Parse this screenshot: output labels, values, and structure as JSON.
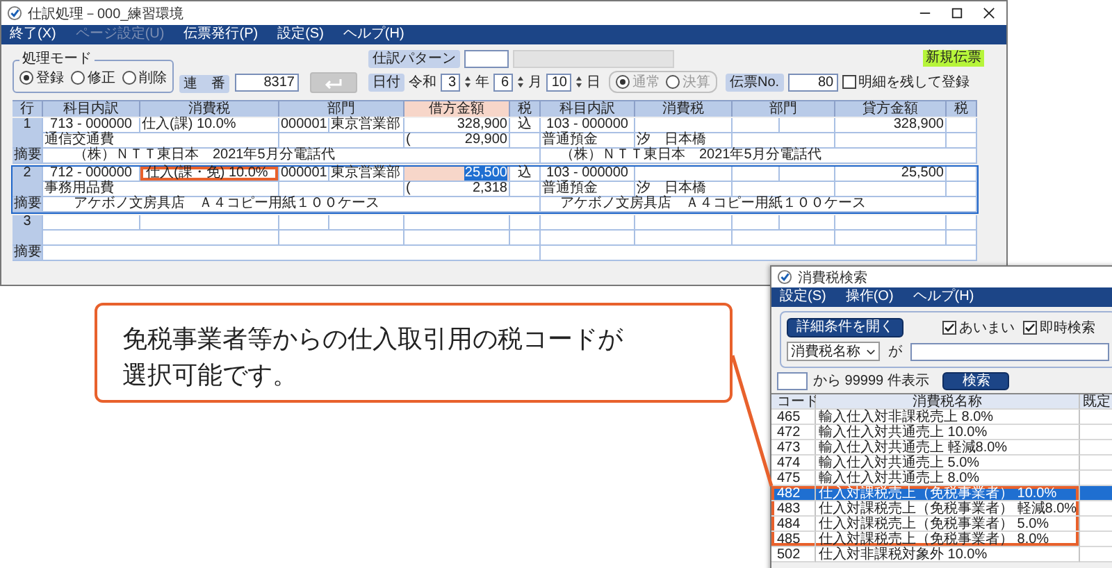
{
  "main_window": {
    "title": "仕訳処理－000_練習環境",
    "menu": [
      {
        "label": "終了(X)",
        "disabled": false
      },
      {
        "label": "ページ設定(U)",
        "disabled": true
      },
      {
        "label": "伝票発行(P)",
        "disabled": false
      },
      {
        "label": "設定(S)",
        "disabled": false
      },
      {
        "label": "ヘルプ(H)",
        "disabled": false
      }
    ],
    "mode": {
      "title": "処理モード",
      "options": [
        {
          "label": "登録",
          "selected": true
        },
        {
          "label": "修正",
          "selected": false
        },
        {
          "label": "削除",
          "selected": false
        }
      ]
    },
    "serial": {
      "label": "連　番",
      "value": "8317"
    },
    "pattern": {
      "label": "仕訳パターン"
    },
    "date": {
      "label": "日付",
      "era": "令和",
      "year": "3",
      "year_unit": "年",
      "month": "6",
      "month_unit": "月",
      "day": "10",
      "day_unit": "日"
    },
    "period": [
      {
        "label": "通常",
        "selected": true
      },
      {
        "label": "決算",
        "selected": false
      }
    ],
    "slip_no": {
      "label": "伝票No.",
      "value": "80"
    },
    "keep_details": {
      "label": "明細を残して登録",
      "checked": false
    },
    "badge": "新規伝票",
    "grid": {
      "columns": [
        "行",
        "科目内訳",
        "消費税",
        "部門",
        "借方金額",
        "税",
        "科目内訳",
        "消費税",
        "部門",
        "貸方金額",
        "税"
      ],
      "entries": [
        {
          "no": "1",
          "summary_label": "摘要",
          "selected": false,
          "debit": {
            "account_code": "713 - 000000",
            "account_name": "通信交通費",
            "tax": "仕入(課) 10.0%",
            "tax_highlighted": false,
            "dept_code": "000001",
            "dept_name": "東京営業部",
            "amount": "328,900",
            "amount_selected": false,
            "tax_bracket": "(",
            "tax_amount": "29,900",
            "tax_mode": "込",
            "summary": "（株）ＮＴＴ東日本　2021年5月分電話代"
          },
          "credit": {
            "account_code": "103 - 000000",
            "account_name": "普通預金",
            "branch": "汐　日本橋",
            "amount": "328,900",
            "summary": "（株）ＮＴＴ東日本　2021年5月分電話代"
          }
        },
        {
          "no": "2",
          "summary_label": "摘要",
          "selected": true,
          "debit": {
            "account_code": "712 - 000000",
            "account_name": "事務用品費",
            "tax": "仕入(課・免) 10.0%",
            "tax_highlighted": true,
            "dept_code": "000001",
            "dept_name": "東京営業部",
            "amount": "25,500",
            "amount_selected": true,
            "tax_bracket": "(",
            "tax_amount": "2,318",
            "tax_mode": "込",
            "summary": "アケボノ文房具店　Ａ４コピー用紙１００ケース"
          },
          "credit": {
            "account_code": "103 - 000000",
            "account_name": "普通預金",
            "branch": "汐　日本橋",
            "amount": "25,500",
            "summary": "アケボノ文房具店　Ａ４コピー用紙１００ケース"
          }
        },
        {
          "no": "3",
          "summary_label": "摘要",
          "selected": false
        }
      ]
    }
  },
  "search_window": {
    "title": "消費税検索",
    "menu": [
      "設定(S)",
      "操作(O)",
      "ヘルプ(H)"
    ],
    "detail_button": "詳細条件を開く",
    "options": [
      {
        "label": "あいまい",
        "checked": true
      },
      {
        "label": "即時検索",
        "checked": true
      }
    ],
    "field_select": "消費税名称",
    "particle": "が",
    "count_text": "から 99999 件表示",
    "search_button": "検索",
    "columns": [
      "コード",
      "消費税名称",
      "既定"
    ],
    "rows": [
      {
        "code": "465",
        "name": "輸入仕入対非課税売上 8.0%",
        "selected": false,
        "highlighted": false
      },
      {
        "code": "472",
        "name": "輸入仕入対共通売上 10.0%",
        "selected": false,
        "highlighted": false
      },
      {
        "code": "473",
        "name": "輸入仕入対共通売上 軽減8.0%",
        "selected": false,
        "highlighted": false
      },
      {
        "code": "474",
        "name": "輸入仕入対共通売上 5.0%",
        "selected": false,
        "highlighted": false
      },
      {
        "code": "475",
        "name": "輸入仕入対共通売上 8.0%",
        "selected": false,
        "highlighted": false
      },
      {
        "code": "482",
        "name": "仕入対課税売上（免税事業者） 10.0%",
        "selected": true,
        "highlighted": true
      },
      {
        "code": "483",
        "name": "仕入対課税売上（免税事業者） 軽減8.0%",
        "selected": false,
        "highlighted": true
      },
      {
        "code": "484",
        "name": "仕入対課税売上（免税事業者） 5.0%",
        "selected": false,
        "highlighted": true
      },
      {
        "code": "485",
        "name": "仕入対課税売上（免税事業者） 8.0%",
        "selected": false,
        "highlighted": true
      },
      {
        "code": "502",
        "name": "仕入対非課税対象外 10.0%",
        "selected": false,
        "highlighted": false
      }
    ]
  },
  "callout": {
    "text": "免税事業者等からの仕入取引用の税コードが選択可能です。"
  }
}
